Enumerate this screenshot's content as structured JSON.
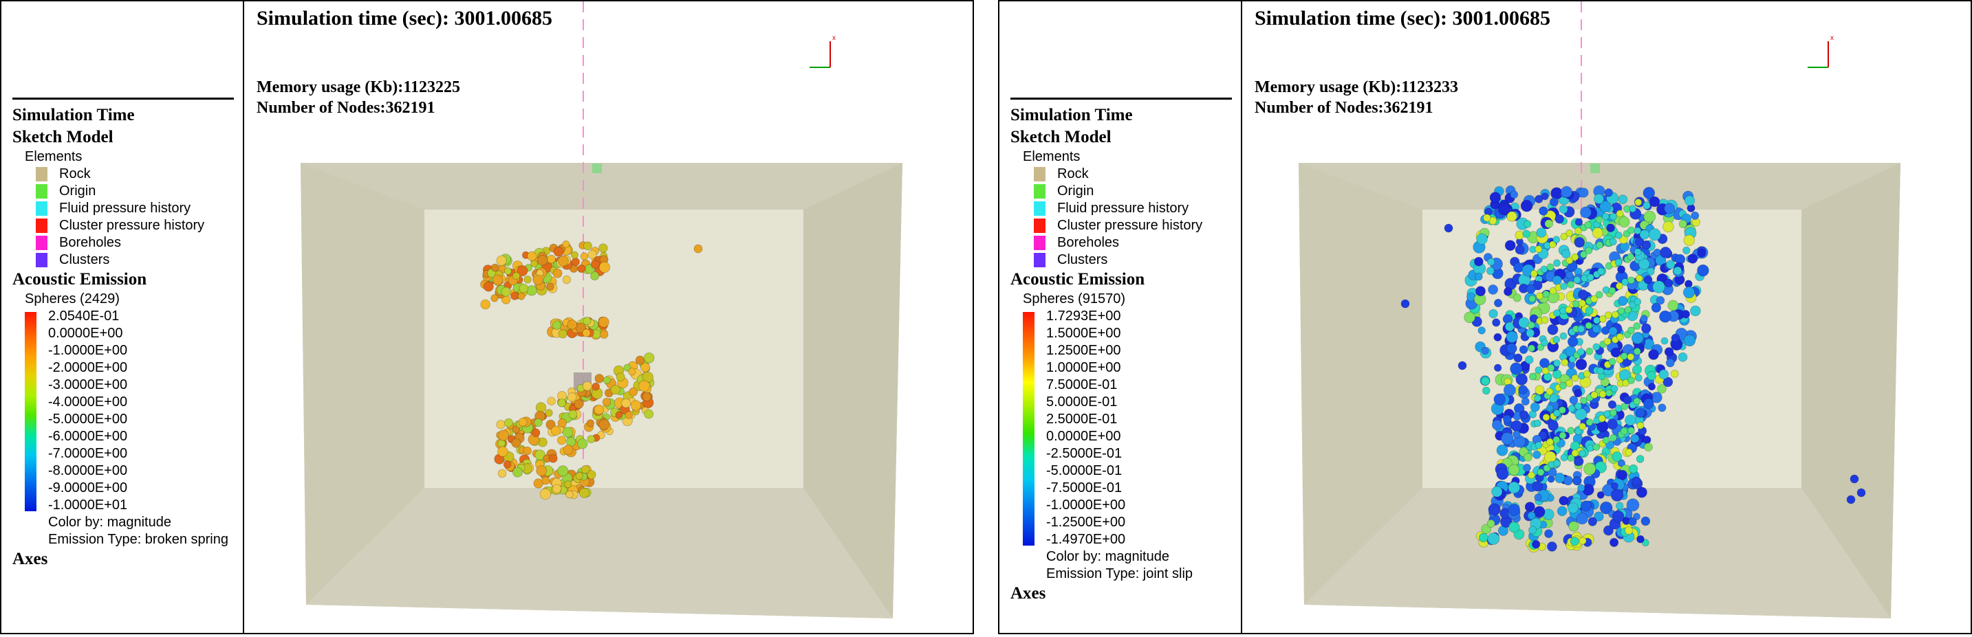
{
  "panels": [
    {
      "legend": {
        "simulation_time": "Simulation Time",
        "sketch_model": "Sketch Model",
        "elements_label": "Elements",
        "elements": [
          {
            "label": "Rock",
            "color": "#c9b98a"
          },
          {
            "label": "Origin",
            "color": "#5ee63c"
          },
          {
            "label": "Fluid pressure history",
            "color": "#2fe9f2"
          },
          {
            "label": "Cluster pressure history",
            "color": "#ff1a10"
          },
          {
            "label": "Boreholes",
            "color": "#ff1fd0"
          },
          {
            "label": "Clusters",
            "color": "#6a30ff"
          }
        ],
        "acoustic_emission": "Acoustic Emission",
        "spheres": "Spheres (2429)",
        "scale": [
          "2.0540E-01",
          "0.0000E+00",
          "-1.0000E+00",
          "-2.0000E+00",
          "-3.0000E+00",
          "-4.0000E+00",
          "-5.0000E+00",
          "-6.0000E+00",
          "-7.0000E+00",
          "-8.0000E+00",
          "-9.0000E+00",
          "-1.0000E+01"
        ],
        "scale_colors": [
          "#ff1400",
          "#ff5a00",
          "#ff8c00",
          "#ffbe00",
          "#e6dc00",
          "#aaf000",
          "#5ae600",
          "#00e66e",
          "#00d2c8",
          "#00a0f0",
          "#0050f0",
          "#0014dc"
        ],
        "color_by": "Color by: magnitude",
        "emission_type": "Emission Type: broken spring",
        "axes": "Axes"
      },
      "view": {
        "sim_time": "Simulation time (sec): 3001.00685",
        "memory": "Memory usage (Kb):1123225",
        "nodes": "Number of Nodes:362191"
      }
    },
    {
      "legend": {
        "simulation_time": "Simulation Time",
        "sketch_model": "Sketch Model",
        "elements_label": "Elements",
        "elements": [
          {
            "label": "Rock",
            "color": "#c9b98a"
          },
          {
            "label": "Origin",
            "color": "#5ee63c"
          },
          {
            "label": "Fluid pressure history",
            "color": "#2fe9f2"
          },
          {
            "label": "Cluster pressure history",
            "color": "#ff1a10"
          },
          {
            "label": "Boreholes",
            "color": "#ff1fd0"
          },
          {
            "label": "Clusters",
            "color": "#6a30ff"
          }
        ],
        "acoustic_emission": "Acoustic Emission",
        "spheres": "Spheres (91570)",
        "scale": [
          "1.7293E+00",
          "1.5000E+00",
          "1.2500E+00",
          "1.0000E+00",
          "7.5000E-01",
          "5.0000E-01",
          "2.5000E-01",
          "0.0000E+00",
          "-2.5000E-01",
          "-5.0000E-01",
          "-7.5000E-01",
          "-1.0000E+00",
          "-1.2500E+00",
          "-1.4970E+00"
        ],
        "scale_colors": [
          "#ff1400",
          "#ff5000",
          "#ff8200",
          "#ffb400",
          "#ffff00",
          "#aaf000",
          "#50e600",
          "#00e650",
          "#00e6b4",
          "#00c8f0",
          "#0096f0",
          "#0064f0",
          "#0032e6",
          "#0014dc"
        ],
        "color_by": "Color by: magnitude",
        "emission_type": "Emission Type: joint slip",
        "axes": "Axes"
      },
      "view": {
        "sim_time": "Simulation time (sec): 3001.00685",
        "memory": "Memory usage (Kb):1123233",
        "nodes": "Number of Nodes:362191"
      }
    }
  ]
}
